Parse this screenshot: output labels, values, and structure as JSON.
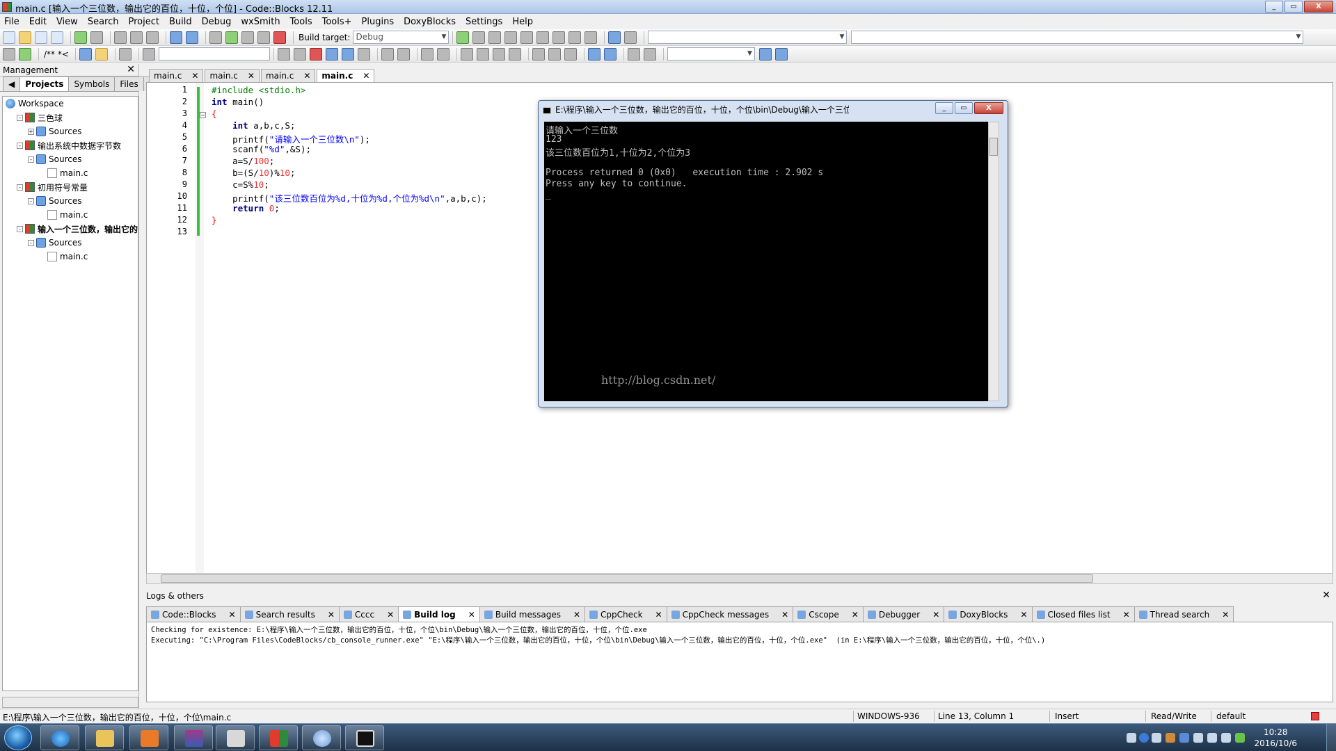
{
  "window": {
    "title": "main.c [输入一个三位数，输出它的百位，十位，个位] - Code::Blocks 12.11"
  },
  "menu": [
    "File",
    "Edit",
    "View",
    "Search",
    "Project",
    "Build",
    "Debug",
    "wxSmith",
    "Tools",
    "Tools+",
    "Plugins",
    "DoxyBlocks",
    "Settings",
    "Help"
  ],
  "toolbar": {
    "build_target_label": "Build target:",
    "build_target_value": "Debug",
    "comment_label": "/** *<"
  },
  "management": {
    "title": "Management",
    "tabs": [
      "Projects",
      "Symbols",
      "Files"
    ],
    "tree": [
      {
        "label": "Workspace",
        "level": 0,
        "type": "ws"
      },
      {
        "label": "三色球",
        "level": 1,
        "type": "proj"
      },
      {
        "label": "Sources",
        "level": 2,
        "type": "fold",
        "exp": "+"
      },
      {
        "label": "输出系统中数据字节数",
        "level": 1,
        "type": "proj"
      },
      {
        "label": "Sources",
        "level": 2,
        "type": "fold",
        "exp": "-"
      },
      {
        "label": "main.c",
        "level": 3,
        "type": "file"
      },
      {
        "label": "初用符号常量",
        "level": 1,
        "type": "proj"
      },
      {
        "label": "Sources",
        "level": 2,
        "type": "fold",
        "exp": "-"
      },
      {
        "label": "main.c",
        "level": 3,
        "type": "file"
      },
      {
        "label": "输入一个三位数，输出它的百",
        "level": 1,
        "type": "proj",
        "bold": true
      },
      {
        "label": "Sources",
        "level": 2,
        "type": "fold",
        "exp": "-"
      },
      {
        "label": "main.c",
        "level": 3,
        "type": "file"
      }
    ]
  },
  "editor_tabs": [
    "main.c",
    "main.c",
    "main.c",
    "main.c"
  ],
  "editor": {
    "line_numbers": [
      "1",
      "2",
      "3",
      "4",
      "5",
      "6",
      "7",
      "8",
      "9",
      "10",
      "11",
      "12",
      "13"
    ],
    "lines": [
      [
        {
          "t": "#include <stdio.h>",
          "c": "pp"
        }
      ],
      [
        {
          "t": "int",
          "c": "kw"
        },
        {
          "t": " main()",
          "c": ""
        }
      ],
      [
        {
          "t": "{",
          "c": "op"
        }
      ],
      [
        {
          "t": "    int",
          "c": "kw"
        },
        {
          "t": " a,b,c,S;",
          "c": ""
        }
      ],
      [
        {
          "t": "    printf(",
          "c": ""
        },
        {
          "t": "\"请输入一个三位数\\n\"",
          "c": "st"
        },
        {
          "t": ");",
          "c": ""
        }
      ],
      [
        {
          "t": "    scanf(",
          "c": ""
        },
        {
          "t": "\"%d\"",
          "c": "st"
        },
        {
          "t": ",&S);",
          "c": ""
        }
      ],
      [
        {
          "t": "    a=S/",
          "c": ""
        },
        {
          "t": "100",
          "c": "nm"
        },
        {
          "t": ";",
          "c": ""
        }
      ],
      [
        {
          "t": "    b=(S/",
          "c": ""
        },
        {
          "t": "10",
          "c": "nm"
        },
        {
          "t": ")%",
          "c": ""
        },
        {
          "t": "10",
          "c": "nm"
        },
        {
          "t": ";",
          "c": ""
        }
      ],
      [
        {
          "t": "    c=S%",
          "c": ""
        },
        {
          "t": "10",
          "c": "nm"
        },
        {
          "t": ";",
          "c": ""
        }
      ],
      [
        {
          "t": "    printf(",
          "c": ""
        },
        {
          "t": "\"该三位数百位为%d,十位为%d,个位为%d\\n\"",
          "c": "st"
        },
        {
          "t": ",a,b,c);",
          "c": ""
        }
      ],
      [
        {
          "t": "    return",
          "c": "kw"
        },
        {
          "t": " ",
          "c": ""
        },
        {
          "t": "0",
          "c": "nm"
        },
        {
          "t": ";",
          "c": ""
        }
      ],
      [
        {
          "t": "}",
          "c": "op"
        }
      ],
      [
        {
          "t": "",
          "c": ""
        }
      ]
    ]
  },
  "console": {
    "title": "E:\\程序\\输入一个三位数，输出它的百位，十位，个位\\bin\\Debug\\输入一个三位数，输出它的百...",
    "lines": [
      "请输入一个三位数",
      "123",
      "该三位数百位为1,十位为2,个位为3",
      "",
      "Process returned 0 (0x0)   execution time : 2.902 s",
      "Press any key to continue.",
      "_"
    ],
    "watermark": "http://blog.csdn.net/"
  },
  "logs": {
    "title": "Logs & others",
    "tabs": [
      "Code::Blocks",
      "Search results",
      "Cccc",
      "Build log",
      "Build messages",
      "CppCheck",
      "CppCheck messages",
      "Cscope",
      "Debugger",
      "DoxyBlocks",
      "Closed files list",
      "Thread search"
    ],
    "active_tab": "Build log",
    "lines": [
      "Checking for existence: E:\\程序\\输入一个三位数，输出它的百位，十位，个位\\bin\\Debug\\输入一个三位数，输出它的百位，十位，个位.exe",
      "Executing: \"C:\\Program Files\\CodeBlocks/cb_console_runner.exe\" \"E:\\程序\\输入一个三位数，输出它的百位，十位，个位\\bin\\Debug\\输入一个三位数，输出它的百位，十位，个位.exe\"  (in E:\\程序\\输入一个三位数，输出它的百位，十位，个位\\.)"
    ]
  },
  "status": {
    "path": "E:\\程序\\输入一个三位数，输出它的百位，十位，个位\\main.c",
    "encoding": "WINDOWS-936",
    "position": "Line 13, Column 1",
    "mode": "Insert",
    "access": "Read/Write",
    "profile": "default"
  },
  "taskbar": {
    "time": "10:28",
    "date": "2016/10/6"
  },
  "colors": {
    "keyword": "#00007f",
    "preprocessor": "#008000",
    "string": "#0000ff",
    "number": "#f03030",
    "fold_bar": "#3fbf3f"
  }
}
